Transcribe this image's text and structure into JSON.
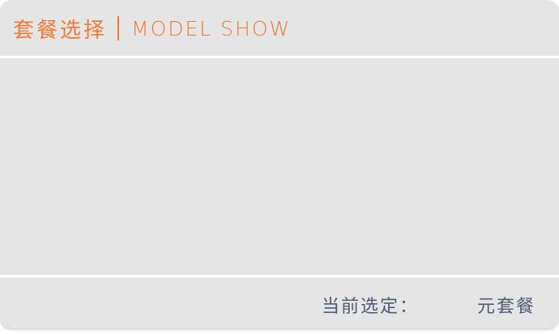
{
  "header": {
    "title_cn": "套餐选择",
    "title_en": "MODEL SHOW"
  },
  "footer": {
    "current_label": "当前选定：",
    "current_value": "",
    "unit_label": "元套餐"
  },
  "colors": {
    "accent": "#f07a38",
    "panel_bg": "#e5e5e5",
    "footer_text": "#4e5a78",
    "divider": "#ffffff"
  }
}
